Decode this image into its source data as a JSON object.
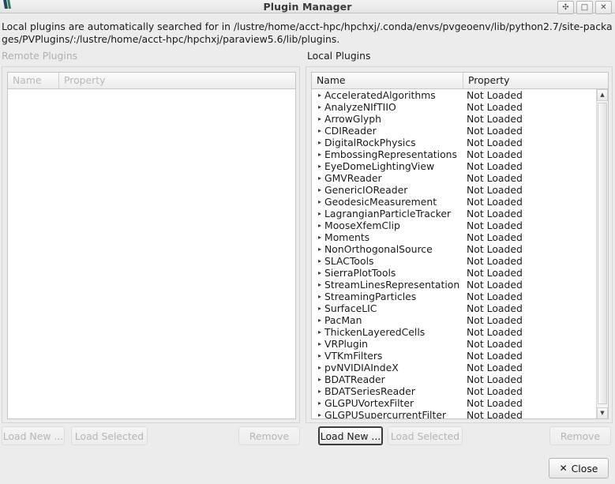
{
  "window": {
    "title": "Plugin Manager",
    "controls": [
      {
        "name": "shade-button",
        "glyph": "✣"
      },
      {
        "name": "maximize-button",
        "glyph": "□"
      },
      {
        "name": "close-window-button",
        "glyph": "✕"
      }
    ]
  },
  "description": "Local plugins are automatically searched for in /lustre/home/acct-hpc/hpchxj/.conda/envs/pvgeoenv/lib/python2.7/site-packages/PVPlugins/:/lustre/home/acct-hpc/hpchxj/paraview5.6/lib/plugins.",
  "remote": {
    "label": "Remote Plugins",
    "columns": {
      "name": "Name",
      "property": "Property"
    },
    "rows": [],
    "buttons": {
      "load_new": "Load New ...",
      "load_selected": "Load Selected",
      "remove": "Remove"
    }
  },
  "local": {
    "label": "Local Plugins",
    "columns": {
      "name": "Name",
      "property": "Property"
    },
    "rows": [
      {
        "name": "AcceleratedAlgorithms",
        "property": "Not Loaded"
      },
      {
        "name": "AnalyzeNIfTIIO",
        "property": "Not Loaded"
      },
      {
        "name": "ArrowGlyph",
        "property": "Not Loaded"
      },
      {
        "name": "CDIReader",
        "property": "Not Loaded"
      },
      {
        "name": "DigitalRockPhysics",
        "property": "Not Loaded"
      },
      {
        "name": "EmbossingRepresentations",
        "property": "Not Loaded"
      },
      {
        "name": "EyeDomeLightingView",
        "property": "Not Loaded"
      },
      {
        "name": "GMVReader",
        "property": "Not Loaded"
      },
      {
        "name": "GenericIOReader",
        "property": "Not Loaded"
      },
      {
        "name": "GeodesicMeasurement",
        "property": "Not Loaded"
      },
      {
        "name": "LagrangianParticleTracker",
        "property": "Not Loaded"
      },
      {
        "name": "MooseXfemClip",
        "property": "Not Loaded"
      },
      {
        "name": "Moments",
        "property": "Not Loaded"
      },
      {
        "name": "NonOrthogonalSource",
        "property": "Not Loaded"
      },
      {
        "name": "SLACTools",
        "property": "Not Loaded"
      },
      {
        "name": "SierraPlotTools",
        "property": "Not Loaded"
      },
      {
        "name": "StreamLinesRepresentation",
        "property": "Not Loaded"
      },
      {
        "name": "StreamingParticles",
        "property": "Not Loaded"
      },
      {
        "name": "SurfaceLIC",
        "property": "Not Loaded"
      },
      {
        "name": "PacMan",
        "property": "Not Loaded"
      },
      {
        "name": "ThickenLayeredCells",
        "property": "Not Loaded"
      },
      {
        "name": "VRPlugin",
        "property": "Not Loaded"
      },
      {
        "name": "VTKmFilters",
        "property": "Not Loaded"
      },
      {
        "name": "pvNVIDIAIndeX",
        "property": "Not Loaded"
      },
      {
        "name": "BDATReader",
        "property": "Not Loaded"
      },
      {
        "name": "BDATSeriesReader",
        "property": "Not Loaded"
      },
      {
        "name": "GLGPUVortexFilter",
        "property": "Not Loaded"
      },
      {
        "name": "GLGPUSupercurrentFilter",
        "property": "Not Loaded"
      }
    ],
    "buttons": {
      "load_new": "Load New ...",
      "load_selected": "Load Selected",
      "remove": "Remove"
    },
    "scrollbar": {
      "up_glyph": "▲",
      "down_glyph": "▼"
    }
  },
  "tree_arrow_glyph": "▸",
  "close_button": {
    "label": "Close",
    "icon_glyph": "✕"
  },
  "colors": {
    "window_background": "#ececec",
    "list_background": "#ffffff",
    "disabled_text": "#b5b5b5",
    "text": "#1a1a1a"
  }
}
